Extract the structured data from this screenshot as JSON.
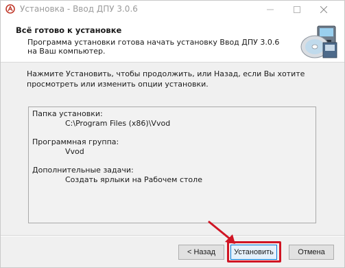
{
  "window": {
    "title": "Установка - Ввод ДПУ 3.0.6",
    "controls": {
      "minimize_icon": "minimize-icon",
      "maximize_icon": "maximize-icon",
      "close_icon": "close-icon"
    }
  },
  "header": {
    "title": "Всё готово к установке",
    "description": "Программа установки готова начать установку Ввод ДПУ 3.0.6 на Ваш компьютер.",
    "icon": "setup-disc-icon"
  },
  "content": {
    "intro": "Нажмите Установить, чтобы продолжить, или Назад, если Вы хотите просмотреть или изменить опции установки.",
    "summary": [
      {
        "label": "Папка установки:",
        "value": "C:\\Program Files (x86)\\Vvod"
      },
      {
        "label": "Программная группа:",
        "value": "Vvod"
      },
      {
        "label": "Дополнительные задачи:",
        "value": "Создать ярлыки на Рабочем столе"
      }
    ]
  },
  "buttons": {
    "back": "< Назад",
    "install": "Установить",
    "cancel": "Отмена"
  },
  "annotation": {
    "highlight_color": "#d01524"
  }
}
